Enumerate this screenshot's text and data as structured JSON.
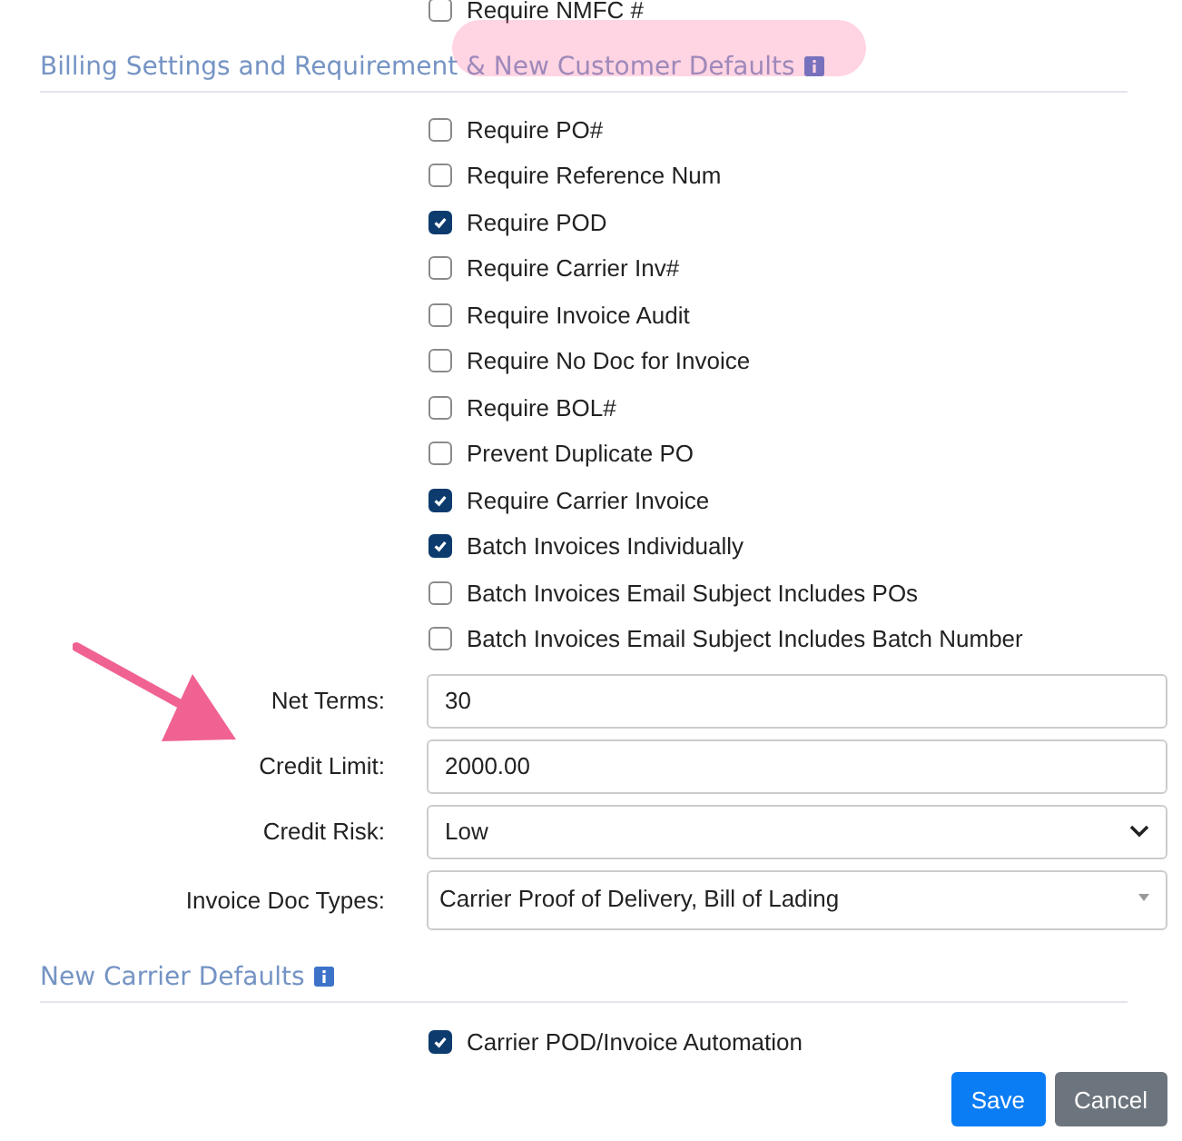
{
  "top_row": {
    "label": "Require NMFC #",
    "checked": false
  },
  "billing_section": {
    "title": "Billing Settings and Requirement & New Customer Defaults",
    "options": [
      {
        "label": "Require PO#",
        "checked": false
      },
      {
        "label": "Require Reference Num",
        "checked": false
      },
      {
        "label": "Require POD",
        "checked": true
      },
      {
        "label": "Require Carrier Inv#",
        "checked": false
      },
      {
        "label": "Require Invoice Audit",
        "checked": false
      },
      {
        "label": "Require No Doc for Invoice",
        "checked": false
      },
      {
        "label": "Require BOL#",
        "checked": false
      },
      {
        "label": "Prevent Duplicate PO",
        "checked": false
      },
      {
        "label": "Require Carrier Invoice",
        "checked": true
      },
      {
        "label": "Batch Invoices Individually",
        "checked": true
      },
      {
        "label": "Batch Invoices Email Subject Includes POs",
        "checked": false
      },
      {
        "label": "Batch Invoices Email Subject Includes Batch Number",
        "checked": false
      }
    ],
    "fields": [
      {
        "kind": "text",
        "label": "Net Terms:",
        "value": "30"
      },
      {
        "kind": "text",
        "label": "Credit Limit:",
        "value": "2000.00"
      },
      {
        "kind": "select",
        "label": "Credit Risk:",
        "value": "Low"
      },
      {
        "kind": "multiselect",
        "label": "Invoice Doc Types:",
        "value": "Carrier Proof of Delivery, Bill of Lading"
      }
    ]
  },
  "carrier_section": {
    "title": "New Carrier Defaults",
    "options": [
      {
        "label": "Carrier POD/Invoice Automation",
        "checked": true
      }
    ]
  },
  "buttons": [
    {
      "kind": "primary",
      "label": "Save"
    },
    {
      "kind": "secondary",
      "label": "Cancel"
    }
  ]
}
